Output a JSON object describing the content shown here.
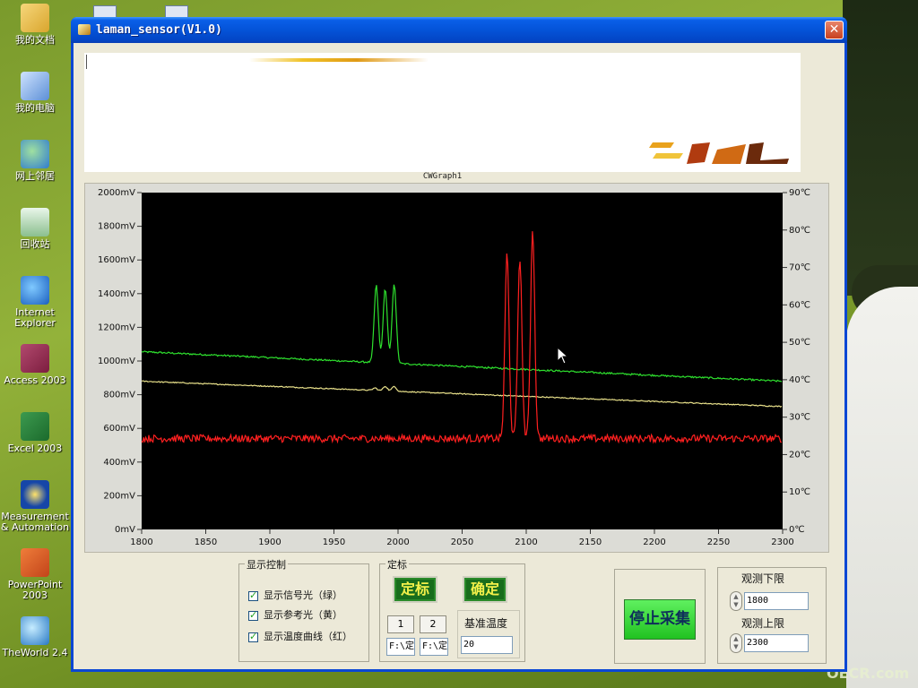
{
  "desktop": {
    "icons": [
      {
        "label": "我的文档",
        "icon": "my-documents-icon"
      },
      {
        "label": "我的电脑",
        "icon": "my-computer-icon"
      },
      {
        "label": "网上邻居",
        "icon": "network-places-icon"
      },
      {
        "label": "回收站",
        "icon": "recycle-bin-icon"
      },
      {
        "label": "Internet Explorer",
        "icon": "internet-explorer-icon"
      },
      {
        "label": "Access 2003",
        "icon": "access-icon"
      },
      {
        "label": "Excel 2003",
        "icon": "excel-icon"
      },
      {
        "label": "Measurement & Automation",
        "icon": "measurement-automation-icon"
      },
      {
        "label": "PowerPoint 2003",
        "icon": "powerpoint-icon"
      },
      {
        "label": "TheWorld 2.4",
        "icon": "theworld-browser-icon"
      }
    ],
    "watermark": "OECR.com"
  },
  "window": {
    "title": "laman_sensor(V1.0)",
    "close_label": "✕",
    "graph_caption": "CWGraph1"
  },
  "chart_data": {
    "type": "line",
    "x_range": [
      1800,
      2300
    ],
    "x_ticks": [
      "1800",
      "1850",
      "1900",
      "1950",
      "2000",
      "2050",
      "2100",
      "2150",
      "2200",
      "2250",
      "2300"
    ],
    "y_left_range": [
      0,
      2000
    ],
    "y_left_ticks": [
      "0mV",
      "200mV",
      "400mV",
      "600mV",
      "800mV",
      "1000mV",
      "1200mV",
      "1400mV",
      "1600mV",
      "1800mV",
      "2000mV"
    ],
    "y_right_range": [
      0,
      90
    ],
    "y_right_ticks": [
      "0℃",
      "10℃",
      "20℃",
      "30℃",
      "40℃",
      "50℃",
      "60℃",
      "70℃",
      "80℃",
      "90℃"
    ],
    "background": "#000000",
    "series": [
      {
        "color": "#2ee02e",
        "axis": "left",
        "baseline": [
          [
            1800,
            1055
          ],
          [
            2300,
            880
          ]
        ],
        "peaks": [
          [
            1983,
            1450
          ],
          [
            1990,
            1430
          ],
          [
            1997,
            1460
          ]
        ]
      },
      {
        "color": "#e8e08a",
        "axis": "left",
        "baseline": [
          [
            1800,
            880
          ],
          [
            2300,
            730
          ]
        ],
        "peaks": [
          [
            1982,
            840
          ],
          [
            1990,
            850
          ],
          [
            1997,
            850
          ]
        ]
      },
      {
        "color": "#ff2020",
        "axis": "left",
        "baseline": [
          [
            1800,
            540
          ],
          [
            2300,
            540
          ]
        ],
        "peaks": [
          [
            2085,
            1640
          ],
          [
            2095,
            1620
          ],
          [
            2105,
            1790
          ]
        ]
      }
    ]
  },
  "display_control": {
    "title": "显示控制",
    "options": [
      {
        "label": "显示信号光（绿）",
        "checked": true
      },
      {
        "label": "显示参考光（黄）",
        "checked": true
      },
      {
        "label": "显示温度曲线（红）",
        "checked": true
      }
    ]
  },
  "calibration": {
    "title": "定标",
    "calibrate_label": "定标",
    "confirm_label": "确定",
    "button_1": "1",
    "button_2": "2",
    "path_1": "F:\\定",
    "path_2": "F:\\定",
    "base_temp_label": "基准温度",
    "base_temp_value": "20"
  },
  "acquisition": {
    "stop_label": "停止采集"
  },
  "observation": {
    "lower_label": "观测下限",
    "lower_value": "1800",
    "upper_label": "观测上限",
    "upper_value": "2300"
  }
}
